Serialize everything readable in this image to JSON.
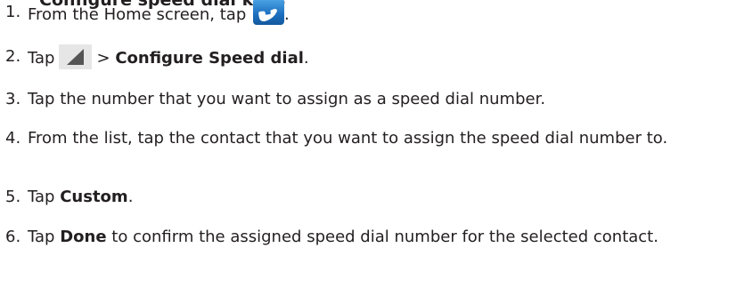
{
  "section_title": "Configure speed dial keys",
  "steps": [
    {
      "number": "1.",
      "text_before": "From the Home screen, tap",
      "text_after": "."
    },
    {
      "number": "2.",
      "text_before": "Tap",
      "separator": ">",
      "bold": "Configure Speed dial",
      "text_after": "."
    },
    {
      "number": "3.",
      "text": "Tap the number that you want to assign as a speed dial number."
    },
    {
      "number": "4.",
      "text": "From the list, tap the contact that you want to assign the speed dial number to."
    },
    {
      "number": "5.",
      "text_before": "Tap",
      "bold": "Custom",
      "text_after": "."
    },
    {
      "number": "6.",
      "text_before": "Tap",
      "bold": "Done",
      "text_after": "to confirm the assigned speed dial number for the selected contact."
    }
  ],
  "icons": {
    "phone": "phone-icon",
    "menu": "menu-icon"
  },
  "colors": {
    "text": "#231f20",
    "phone_icon_blue": "#1d6fbf",
    "menu_icon_bg": "#e6e6e6"
  }
}
